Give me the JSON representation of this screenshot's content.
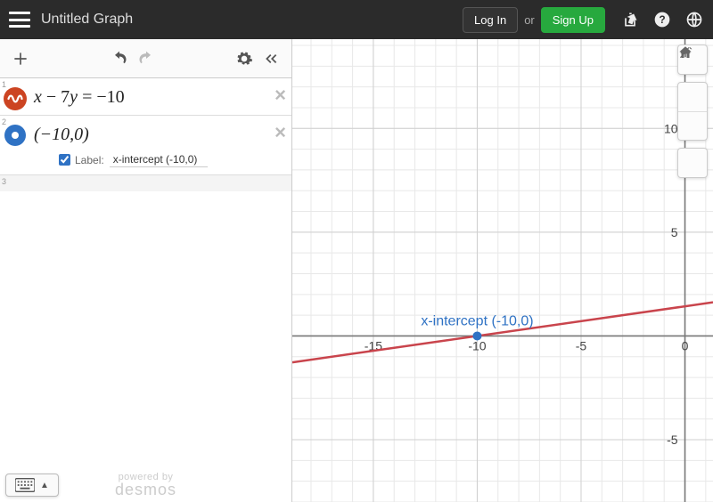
{
  "header": {
    "title": "Untitled Graph",
    "login": "Log In",
    "or": "or",
    "signup": "Sign Up"
  },
  "expressions": [
    {
      "idx": "1",
      "type": "equation",
      "latex": "x − 7y = −10"
    },
    {
      "idx": "2",
      "type": "point",
      "latex": "(−10,0)",
      "label_checked": true,
      "label_prefix": "Label:",
      "label_value": "x-intercept (-10,0)"
    },
    {
      "idx": "3",
      "type": "empty"
    }
  ],
  "footer": {
    "powered": "powered by",
    "brand": "desmos"
  },
  "chart_data": {
    "type": "line",
    "title": "",
    "xlabel": "",
    "ylabel": "",
    "xlim": [
      -18.9,
      1.35
    ],
    "ylim": [
      -8.0,
      14.3
    ],
    "x_ticks": [
      -15,
      -10,
      -5,
      0
    ],
    "y_ticks": [
      -5,
      5,
      10
    ],
    "grid": true,
    "series": [
      {
        "name": "x − 7y = −10",
        "color": "#c9444c",
        "equation": "y = (x + 10) / 7",
        "points": [
          [
            -18.9,
            -1.271
          ],
          [
            1.35,
            1.621
          ]
        ]
      }
    ],
    "marked_points": [
      {
        "name": "x-intercept",
        "coords": [
          -10,
          0
        ],
        "label": "x-intercept (-10,0)",
        "color": "#2f72c4"
      }
    ]
  }
}
